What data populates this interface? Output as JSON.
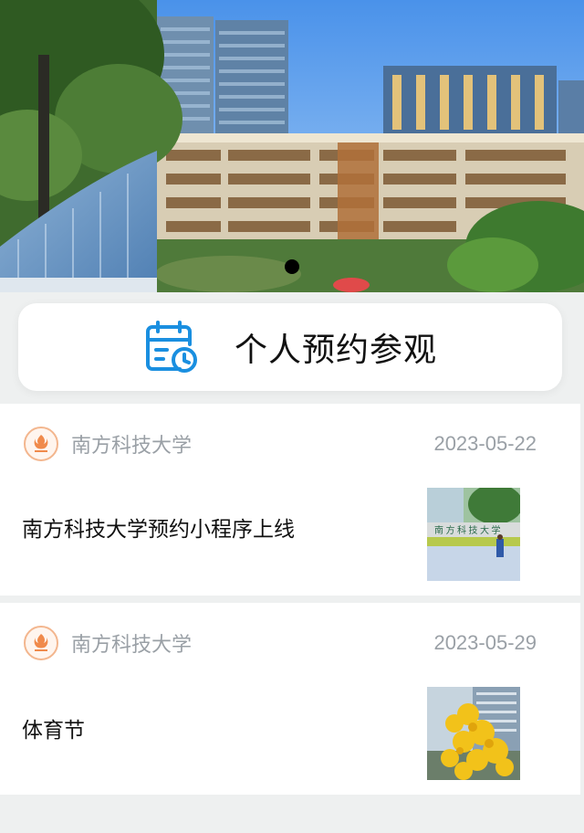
{
  "banner": {
    "image_alt": "campus-buildings-photo",
    "slides_total": 1,
    "active_slide": 1
  },
  "reserve": {
    "label": "个人预约参观",
    "icon": "calendar-clock-icon",
    "icon_color": "#1a8fe0"
  },
  "news": [
    {
      "source": "南方科技大学",
      "date": "2023-05-22",
      "title": "南方科技大学预约小程序上线",
      "thumbnail": "campus-entrance-photo"
    },
    {
      "source": "南方科技大学",
      "date": "2023-05-29",
      "title": "体育节",
      "thumbnail": "yellow-flowers-photo"
    }
  ],
  "colors": {
    "background": "#eef0f0",
    "meta_text": "#9aa0a6",
    "title_text": "#111111",
    "logo_accent": "#f08a4b"
  }
}
